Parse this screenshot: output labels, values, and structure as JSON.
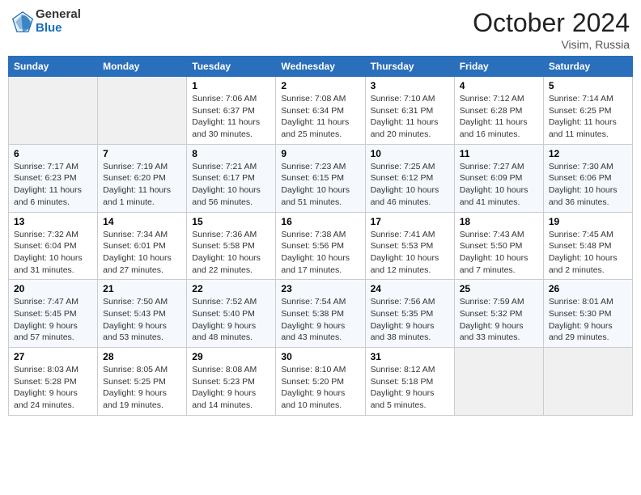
{
  "header": {
    "logo_general": "General",
    "logo_blue": "Blue",
    "month_year": "October 2024",
    "location": "Visim, Russia"
  },
  "weekdays": [
    "Sunday",
    "Monday",
    "Tuesday",
    "Wednesday",
    "Thursday",
    "Friday",
    "Saturday"
  ],
  "weeks": [
    [
      {
        "day": "",
        "content": ""
      },
      {
        "day": "",
        "content": ""
      },
      {
        "day": "1",
        "content": "Sunrise: 7:06 AM\nSunset: 6:37 PM\nDaylight: 11 hours and 30 minutes."
      },
      {
        "day": "2",
        "content": "Sunrise: 7:08 AM\nSunset: 6:34 PM\nDaylight: 11 hours and 25 minutes."
      },
      {
        "day": "3",
        "content": "Sunrise: 7:10 AM\nSunset: 6:31 PM\nDaylight: 11 hours and 20 minutes."
      },
      {
        "day": "4",
        "content": "Sunrise: 7:12 AM\nSunset: 6:28 PM\nDaylight: 11 hours and 16 minutes."
      },
      {
        "day": "5",
        "content": "Sunrise: 7:14 AM\nSunset: 6:25 PM\nDaylight: 11 hours and 11 minutes."
      }
    ],
    [
      {
        "day": "6",
        "content": "Sunrise: 7:17 AM\nSunset: 6:23 PM\nDaylight: 11 hours and 6 minutes."
      },
      {
        "day": "7",
        "content": "Sunrise: 7:19 AM\nSunset: 6:20 PM\nDaylight: 11 hours and 1 minute."
      },
      {
        "day": "8",
        "content": "Sunrise: 7:21 AM\nSunset: 6:17 PM\nDaylight: 10 hours and 56 minutes."
      },
      {
        "day": "9",
        "content": "Sunrise: 7:23 AM\nSunset: 6:15 PM\nDaylight: 10 hours and 51 minutes."
      },
      {
        "day": "10",
        "content": "Sunrise: 7:25 AM\nSunset: 6:12 PM\nDaylight: 10 hours and 46 minutes."
      },
      {
        "day": "11",
        "content": "Sunrise: 7:27 AM\nSunset: 6:09 PM\nDaylight: 10 hours and 41 minutes."
      },
      {
        "day": "12",
        "content": "Sunrise: 7:30 AM\nSunset: 6:06 PM\nDaylight: 10 hours and 36 minutes."
      }
    ],
    [
      {
        "day": "13",
        "content": "Sunrise: 7:32 AM\nSunset: 6:04 PM\nDaylight: 10 hours and 31 minutes."
      },
      {
        "day": "14",
        "content": "Sunrise: 7:34 AM\nSunset: 6:01 PM\nDaylight: 10 hours and 27 minutes."
      },
      {
        "day": "15",
        "content": "Sunrise: 7:36 AM\nSunset: 5:58 PM\nDaylight: 10 hours and 22 minutes."
      },
      {
        "day": "16",
        "content": "Sunrise: 7:38 AM\nSunset: 5:56 PM\nDaylight: 10 hours and 17 minutes."
      },
      {
        "day": "17",
        "content": "Sunrise: 7:41 AM\nSunset: 5:53 PM\nDaylight: 10 hours and 12 minutes."
      },
      {
        "day": "18",
        "content": "Sunrise: 7:43 AM\nSunset: 5:50 PM\nDaylight: 10 hours and 7 minutes."
      },
      {
        "day": "19",
        "content": "Sunrise: 7:45 AM\nSunset: 5:48 PM\nDaylight: 10 hours and 2 minutes."
      }
    ],
    [
      {
        "day": "20",
        "content": "Sunrise: 7:47 AM\nSunset: 5:45 PM\nDaylight: 9 hours and 57 minutes."
      },
      {
        "day": "21",
        "content": "Sunrise: 7:50 AM\nSunset: 5:43 PM\nDaylight: 9 hours and 53 minutes."
      },
      {
        "day": "22",
        "content": "Sunrise: 7:52 AM\nSunset: 5:40 PM\nDaylight: 9 hours and 48 minutes."
      },
      {
        "day": "23",
        "content": "Sunrise: 7:54 AM\nSunset: 5:38 PM\nDaylight: 9 hours and 43 minutes."
      },
      {
        "day": "24",
        "content": "Sunrise: 7:56 AM\nSunset: 5:35 PM\nDaylight: 9 hours and 38 minutes."
      },
      {
        "day": "25",
        "content": "Sunrise: 7:59 AM\nSunset: 5:32 PM\nDaylight: 9 hours and 33 minutes."
      },
      {
        "day": "26",
        "content": "Sunrise: 8:01 AM\nSunset: 5:30 PM\nDaylight: 9 hours and 29 minutes."
      }
    ],
    [
      {
        "day": "27",
        "content": "Sunrise: 8:03 AM\nSunset: 5:28 PM\nDaylight: 9 hours and 24 minutes."
      },
      {
        "day": "28",
        "content": "Sunrise: 8:05 AM\nSunset: 5:25 PM\nDaylight: 9 hours and 19 minutes."
      },
      {
        "day": "29",
        "content": "Sunrise: 8:08 AM\nSunset: 5:23 PM\nDaylight: 9 hours and 14 minutes."
      },
      {
        "day": "30",
        "content": "Sunrise: 8:10 AM\nSunset: 5:20 PM\nDaylight: 9 hours and 10 minutes."
      },
      {
        "day": "31",
        "content": "Sunrise: 8:12 AM\nSunset: 5:18 PM\nDaylight: 9 hours and 5 minutes."
      },
      {
        "day": "",
        "content": ""
      },
      {
        "day": "",
        "content": ""
      }
    ]
  ]
}
